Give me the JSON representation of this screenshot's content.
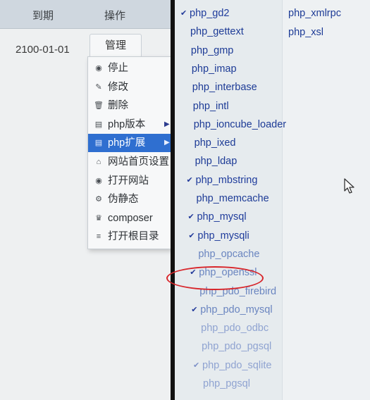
{
  "table": {
    "headers": {
      "expire": "到期",
      "action": "操作"
    },
    "row": {
      "expire_date": "2100-01-01",
      "manage_label": "管理"
    }
  },
  "context_menu": {
    "items": [
      {
        "icon": "stop-icon",
        "glyph": "◉",
        "label": "停止",
        "submenu": false,
        "active": false
      },
      {
        "icon": "edit-icon",
        "glyph": "✎",
        "label": "修改",
        "submenu": false,
        "active": false
      },
      {
        "icon": "delete-icon",
        "glyph": "🗑",
        "label": "删除",
        "submenu": false,
        "active": false
      },
      {
        "icon": "php-version-icon",
        "glyph": "▤",
        "label": "php版本",
        "submenu": true,
        "active": false
      },
      {
        "icon": "php-extension-icon",
        "glyph": "▤",
        "label": "php扩展",
        "submenu": true,
        "active": true
      },
      {
        "icon": "home-page-icon",
        "glyph": "⌂",
        "label": "网站首页设置",
        "submenu": false,
        "active": false
      },
      {
        "icon": "open-site-icon",
        "glyph": "◉",
        "label": "打开网站",
        "submenu": false,
        "active": false
      },
      {
        "icon": "rewrite-icon",
        "glyph": "⚙",
        "label": "伪静态",
        "submenu": false,
        "active": false
      },
      {
        "icon": "composer-icon",
        "glyph": "♛",
        "label": "composer",
        "submenu": false,
        "active": false
      },
      {
        "icon": "folder-icon",
        "glyph": "≡",
        "label": "打开根目录",
        "submenu": false,
        "active": false
      }
    ]
  },
  "extensions": {
    "left_column": [
      {
        "name": "php_gd2",
        "checked": true
      },
      {
        "name": "php_gettext",
        "checked": false
      },
      {
        "name": "php_gmp",
        "checked": false
      },
      {
        "name": "php_imap",
        "checked": false
      },
      {
        "name": "php_interbase",
        "checked": false
      },
      {
        "name": "php_intl",
        "checked": false
      },
      {
        "name": "php_ioncube_loader",
        "checked": false
      },
      {
        "name": "php_ixed",
        "checked": false
      },
      {
        "name": "php_ldap",
        "checked": false
      },
      {
        "name": "php_mbstring",
        "checked": true
      },
      {
        "name": "php_memcache",
        "checked": false
      },
      {
        "name": "php_mysql",
        "checked": true
      },
      {
        "name": "php_mysqli",
        "checked": true
      },
      {
        "name": "php_opcache",
        "checked": false
      },
      {
        "name": "php_openssl",
        "checked": true
      },
      {
        "name": "php_pdo_firebird",
        "checked": false
      },
      {
        "name": "php_pdo_mysql",
        "checked": true
      },
      {
        "name": "php_pdo_odbc",
        "checked": false
      },
      {
        "name": "php_pdo_pgsql",
        "checked": false
      },
      {
        "name": "php_pdo_sqlite",
        "checked": true
      },
      {
        "name": "php_pgsql",
        "checked": false
      }
    ],
    "right_column": [
      {
        "name": "php_xmlrpc",
        "checked": false
      },
      {
        "name": "php_xsl",
        "checked": false
      }
    ],
    "check_mark": "✔",
    "highlighted": "php_openssl"
  },
  "colors": {
    "menu_active_bg": "#2f6fd0",
    "link_blue": "#1d3b96",
    "highlight_ring": "#d8262b"
  }
}
